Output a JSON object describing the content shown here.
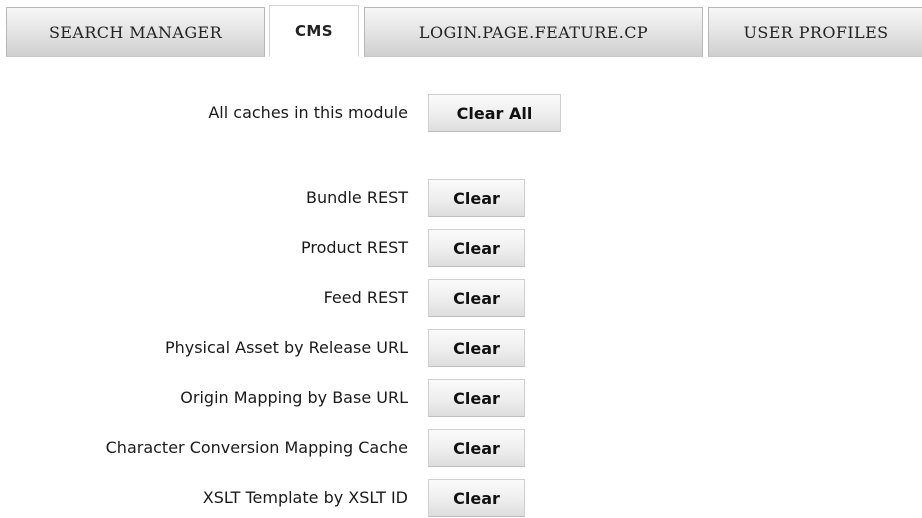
{
  "tabs": [
    {
      "label": "SEARCH MANAGER",
      "active": false
    },
    {
      "label": "CMS",
      "active": true
    },
    {
      "label": "LOGIN.PAGE.FEATURE.CP",
      "active": false
    },
    {
      "label": "USER PROFILES",
      "active": false
    }
  ],
  "clear_all": {
    "label": "All caches in this module",
    "button": "Clear All"
  },
  "caches": [
    {
      "label": "Bundle REST",
      "button": "Clear"
    },
    {
      "label": "Product REST",
      "button": "Clear"
    },
    {
      "label": "Feed REST",
      "button": "Clear"
    },
    {
      "label": "Physical Asset by Release URL",
      "button": "Clear"
    },
    {
      "label": "Origin Mapping by Base URL",
      "button": "Clear"
    },
    {
      "label": "Character Conversion Mapping Cache",
      "button": "Clear"
    },
    {
      "label": "XSLT Template by XSLT ID",
      "button": "Clear"
    }
  ]
}
